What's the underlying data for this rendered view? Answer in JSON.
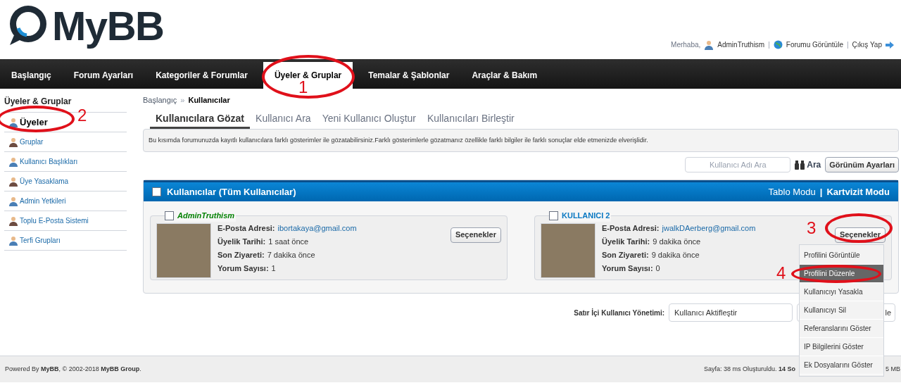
{
  "header": {
    "logo": "MyBB",
    "greeting": "Merhaba,",
    "user_link": "AdminTruthism",
    "view_forum": "Forumu Görüntüle",
    "logout": "Çıkış Yap",
    "separators": [
      "|",
      "|"
    ]
  },
  "nav": [
    {
      "label": "Başlangıç",
      "selected": false
    },
    {
      "label": "Forum Ayarları",
      "selected": false
    },
    {
      "label": "Kategoriler & Forumlar",
      "selected": false
    },
    {
      "label": "Üyeler & Gruplar",
      "selected": true
    },
    {
      "label": "Temalar & Şablonlar",
      "selected": false
    },
    {
      "label": "Araçlar & Bakım",
      "selected": false
    }
  ],
  "sidebar": {
    "title": "Üyeler & Gruplar",
    "items": [
      {
        "label": "Üyeler",
        "selected": true
      },
      {
        "label": "Gruplar",
        "selected": false
      },
      {
        "label": "Kullanıcı Başlıkları",
        "selected": false
      },
      {
        "label": "Üye Yasaklama",
        "selected": false
      },
      {
        "label": "Admin Yetkileri",
        "selected": false
      },
      {
        "label": "Toplu E-Posta Sistemi",
        "selected": false
      },
      {
        "label": "Terfi Grupları",
        "selected": false
      }
    ]
  },
  "breadcrumb": [
    "Başlangıç",
    "»",
    "Kullanıcılar"
  ],
  "tabs": [
    {
      "label": "Kullanıcılara Gözat",
      "selected": true
    },
    {
      "label": "Kullanıcı Ara",
      "selected": false
    },
    {
      "label": "Yeni Kullanıcı Oluştur",
      "selected": false
    },
    {
      "label": "Kullanıcıları Birleştir",
      "selected": false
    }
  ],
  "description": "Bu kısımda forumunuzda kayıtlı kullanıcılara farklı gösterimler ile gözatabilirsiniz.Farklı gösterimlerle gözatmanız özellikle farklı bilgiler ile farklı sonuçlar elde etmenizde elverişlidir.",
  "search": {
    "placeholder": "Kullanıcı Adı Ara",
    "button": "Ara",
    "view_settings": "Görünüm Ayarları"
  },
  "panel": {
    "title": "Kullanıcılar (Tüm Kullanıcılar)",
    "checked": false,
    "modes": [
      {
        "label": "Tablo Modu",
        "selected": false
      },
      {
        "label": "Kartvizit Modu",
        "selected": true
      }
    ],
    "mode_separator": "|",
    "cards": [
      {
        "name": "AdminTruthism",
        "color": "#008000",
        "italic": true,
        "checked": false,
        "options": "Seçenekler",
        "fields": [
          {
            "label": "E-Posta Adresi:",
            "value": "ibortakaya@gmail.com",
            "kind": "link"
          },
          {
            "label": "Üyelik Tarihi:",
            "value": "1 saat önce",
            "kind": "text"
          },
          {
            "label": "Son Ziyareti:",
            "value": "7 dakika önce",
            "kind": "text"
          },
          {
            "label": "Yorum Sayısı:",
            "value": "1",
            "kind": "text"
          }
        ]
      },
      {
        "name": "KULLANICI 2",
        "color": "#0a78c2",
        "italic": false,
        "checked": false,
        "options": "Seçenekler",
        "fields": [
          {
            "label": "E-Posta Adresi:",
            "value": "jwalkDAerberg@gmail.com",
            "kind": "link"
          },
          {
            "label": "Üyelik Tarihi:",
            "value": "9 dakika önce",
            "kind": "text"
          },
          {
            "label": "Son Ziyareti:",
            "value": "9 dakika önce",
            "kind": "text"
          },
          {
            "label": "Yorum Sayısı:",
            "value": "0",
            "kind": "text"
          }
        ]
      }
    ]
  },
  "inline": {
    "label": "Satır İçi Kullanıcı Yönetimi:",
    "value": "Kullanıcı Aktifleştir",
    "button": "le"
  },
  "menu": [
    {
      "label": "Profilini Görüntüle",
      "selected": false
    },
    {
      "label": "Profilini Düzenle",
      "selected": true
    },
    {
      "label": "Kullanıcıyı Yasakla",
      "selected": false
    },
    {
      "label": "Kullanıcıyı Sil",
      "selected": false
    },
    {
      "label": "Referanslarını Göster",
      "selected": false
    },
    {
      "label": "IP Bilgilerini Göster",
      "selected": false
    },
    {
      "label": "Ek Dosyalarını Göster",
      "selected": false
    }
  ],
  "footer": {
    "left": "Powered By **MyBB**, © 2002-2018 **MyBB Group**.",
    "right": "Sayfa: 38 ms Oluşturuldu. **14 So**",
    "right_tail": "5 MB"
  },
  "annotations": [
    {
      "number": "1"
    },
    {
      "number": "2"
    },
    {
      "number": "3"
    },
    {
      "number": "4"
    }
  ]
}
